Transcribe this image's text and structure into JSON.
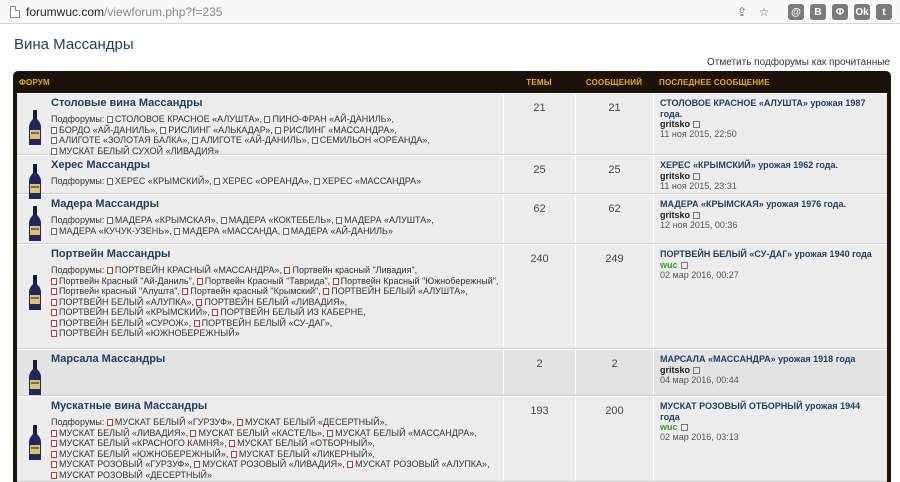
{
  "browser": {
    "url_host": "forumwuc.com",
    "url_path": "/viewforum.php?f=235",
    "extensions": [
      "@",
      "В",
      "Ф",
      "Ok",
      "t"
    ]
  },
  "page": {
    "title": "Вина Массандры",
    "mark_read": "Отметить подфорумы как прочитанные",
    "subforums_label": "Подфорумы:"
  },
  "table_header": {
    "forum": "ФОРУМ",
    "topics": "ТЕМЫ",
    "posts": "СООБЩЕНИЙ",
    "last_post": "ПОСЛЕДНЕЕ СООБЩЕНИЕ"
  },
  "forums": [
    {
      "name": "Столовые вина Массандры",
      "topics": "21",
      "posts": "21",
      "subforums": [
        "СТОЛОВОЕ КРАСНОЕ «АЛУШТА»",
        "ПИНО-ФРАН «АЙ-ДАНИЛЬ»",
        "БОРДО «АЙ-ДАНИЛЬ»",
        "РИСЛИНГ «АЛЬКАДАР»",
        "РИСЛИНГ «МАССАНДРА»",
        "АЛИГОТЕ «ЗОЛОТАЯ БАЛКА»",
        "АЛИГОТЕ «АЙ-ДАНИЛЬ»",
        "СЕМИЛЬОН «ОРЕАНДА»",
        "МУСКАТ БЕЛЫЙ СУХОЙ «ЛИВАДИЯ»"
      ],
      "last_title": "СТОЛОВОЕ КРАСНОЕ «АЛУШТА» урожая 1987 года.",
      "last_user": "gritsko",
      "last_date": "11 ноя 2015, 22:50"
    },
    {
      "name": "Херес Массандры",
      "topics": "25",
      "posts": "25",
      "subforums": [
        "ХЕРЕС «КРЫМСКИЙ»",
        "ХЕРЕС «ОРЕАНДА»",
        "ХЕРЕС «МАССАНДРА»"
      ],
      "last_title": "ХЕРЕС «КРЫМСКИЙ» урожая 1962 года.",
      "last_user": "gritsko",
      "last_date": "11 ноя 2015, 23:31"
    },
    {
      "name": "Мадера Массандры",
      "topics": "62",
      "posts": "62",
      "subforums": [
        "МАДЕРА «КРЫМСКАЯ»",
        "МАДЕРА «КОКТЕБЕЛЬ»",
        "МАДЕРА «АЛУШТА»",
        "МАДЕРА «КУЧУК-УЗЕНЬ»",
        "МАДЕРА «МАССАНДА",
        "МАДЕРА «АЙ-ДАНИЛЬ»"
      ],
      "last_title": "МАДЕРА «КРЫМСКАЯ» урожая 1976 года.",
      "last_user": "gritsko",
      "last_date": "12 ноя 2015, 00:36"
    },
    {
      "name": "Портвейн Массандры",
      "topics": "240",
      "posts": "249",
      "subforums": [
        "ПОРТВЕЙН КРАСНЫЙ «МАССАНДРА»",
        "Портвейн красный \"Ливадия\"",
        "Портвейн Красный \"Ай-Даниль\"",
        "Портвейн Красный \"Таврида\"",
        "Портвейн Красный \"Южнобережный\"",
        "Портвейн красный \"Алушта\"",
        "Портвейн красный \"Крымский\"",
        "ПОРТВЕЙН БЕЛЫЙ «АЛУШТА»",
        "ПОРТВЕЙН БЕЛЫЙ «АЛУПКА»",
        "ПОРТВЕЙН БЕЛЫЙ «ЛИВАДИЯ»",
        "ПОРТВЕЙН БЕЛЫЙ «КРЫМСКИЙ»",
        "ПОРТВЕЙН БЕЛЫЙ ИЗ КАБЕРНЕ",
        "ПОРТВЕЙН БЕЛЫЙ «СУРОЖ»",
        "ПОРТВЕЙН БЕЛЫЙ «СУ-ДАГ»",
        "ПОРТВЕЙН БЕЛЫЙ «ЮЖНОБЕРЕЖНЫЙ»"
      ],
      "last_title": "ПОРТВЕЙН БЕЛЫЙ «СУ-ДАГ» урожая 1940 года",
      "last_user": "wuc",
      "last_date": "02 мар 2016, 00:27"
    },
    {
      "name": "Марсала Массандры",
      "topics": "2",
      "posts": "2",
      "subforums": [],
      "last_title": "МАРСАЛА «МАССАНДРА» урожая 1918 года",
      "last_user": "gritsko",
      "last_date": "04 мар 2016, 00:44"
    },
    {
      "name": "Мускатные вина Массандры",
      "topics": "193",
      "posts": "200",
      "subforums": [
        "МУСКАТ БЕЛЫЙ «ГУРЗУФ»",
        "МУСКАТ БЕЛЫЙ «ДЕСЕРТНЫЙ»",
        "МУСКАТ БЕЛЫЙ «ЛИВАДИЯ»",
        "МУСКАТ БЕЛЫЙ «КАСТЕЛЬ»",
        "МУСКАТ БЕЛЫЙ «МАССАНДРА»",
        "МУСКАТ БЕЛЫЙ «КРАСНОГО КАМНЯ»",
        "МУСКАТ БЕЛЫЙ «ОТБОРНЫЙ»",
        "МУСКАТ БЕЛЫЙ «ЮЖНОБЕРЕЖНЫЙ»",
        "МУСКАТ БЕЛЫЙ «ЛИКЕРНЫЙ»",
        "МУСКАТ РОЗОВЫЙ «ГУРЗУФ»",
        "МУСКАТ РОЗОВЫЙ «ЛИВАДИЯ»",
        "МУСКАТ РОЗОВЫЙ «АЛУПКА»",
        "МУСКАТ РОЗОВЫЙ «ДЕСЕРТНЫЙ»"
      ],
      "last_title": "МУСКАТ РОЗОВЫЙ ОТБОРНЫЙ урожая 1944 года",
      "last_user": "wuc",
      "last_date": "02 мар 2016, 03:13"
    }
  ],
  "colors": {
    "header_bg": "#1b1209",
    "header_text": "#f0b000",
    "link": "#1f3d5c",
    "user_green": "#2e9a2e",
    "subforum_icon_red": "#c0392b"
  }
}
